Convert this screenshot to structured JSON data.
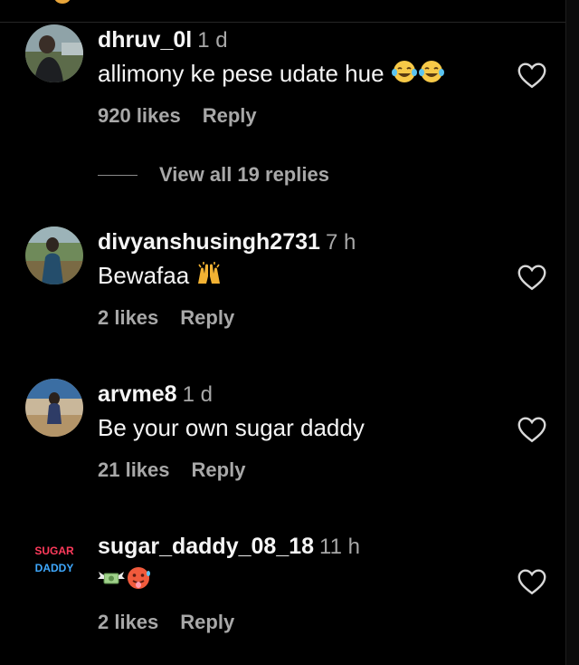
{
  "colors": {
    "background": "#000000",
    "primary_text": "#f5f5f5",
    "secondary_text": "#a8a8a8",
    "divider": "#262626"
  },
  "comments": [
    {
      "username": "dhruv_0l",
      "time": "1 d",
      "text": "allimony ke pese udate hue",
      "emoji": [
        "face-with-tears-of-joy-emoji",
        "face-with-tears-of-joy-emoji"
      ],
      "likes": "920 likes",
      "reply_label": "Reply",
      "view_replies": "View all 19 replies"
    },
    {
      "username": "divyanshusingh2731",
      "time": "7 h",
      "text": "Bewafaa",
      "emoji": [
        "raising-hands-emoji"
      ],
      "likes": "2 likes",
      "reply_label": "Reply"
    },
    {
      "username": "arvme8",
      "time": "1 d",
      "text": "Be your own sugar daddy",
      "emoji": [],
      "likes": "21 likes",
      "reply_label": "Reply"
    },
    {
      "username": "sugar_daddy_08_18",
      "time": "11 h",
      "text": "",
      "emoji": [
        "money-with-wings-emoji",
        "hot-face-emoji"
      ],
      "likes": "2 likes",
      "reply_label": "Reply",
      "avatar_text": [
        "SUGAR",
        "DADDY"
      ]
    }
  ],
  "icons": {
    "like": "heart-outline-icon"
  }
}
